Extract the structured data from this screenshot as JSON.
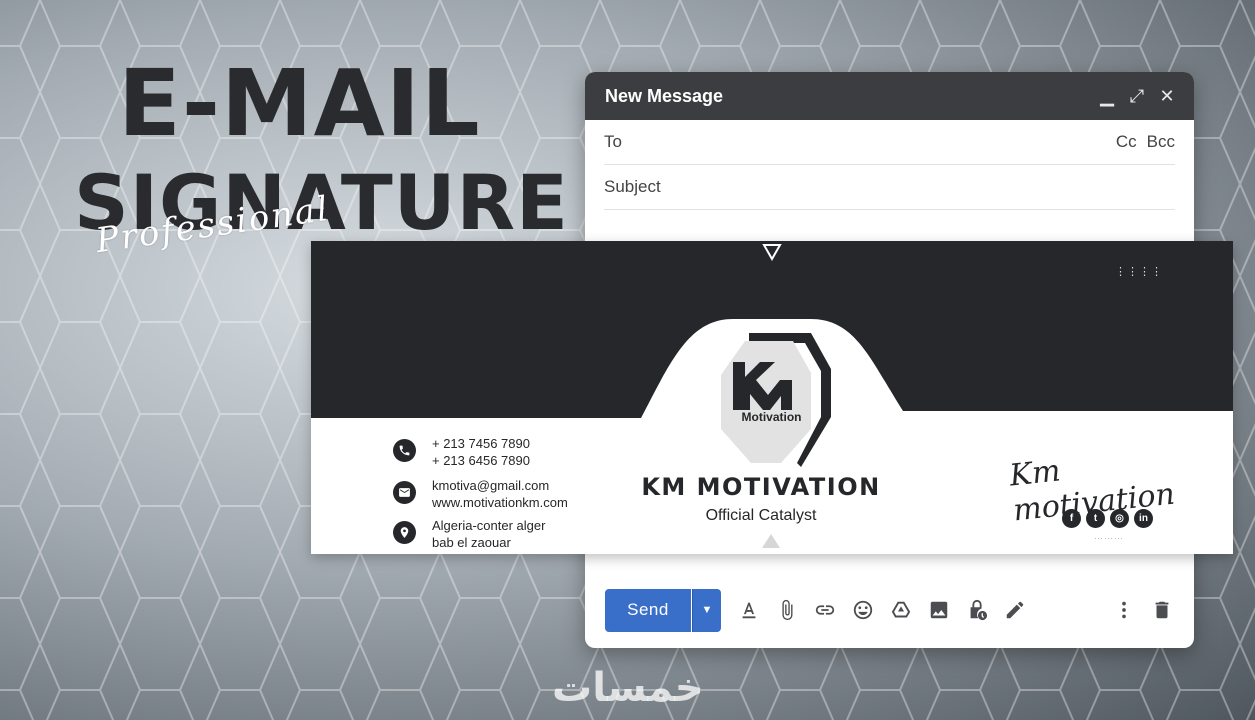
{
  "hero": {
    "line1": "E-MAIL",
    "line2": "SIGNATURE",
    "script": "Professional"
  },
  "compose": {
    "title": "New Message",
    "controls": [
      "minimize-icon",
      "expand-icon",
      "close-icon"
    ],
    "to_label": "To",
    "cc_label": "Cc",
    "bcc_label": "Bcc",
    "subject_label": "Subject",
    "send_label": "Send",
    "toolbar_icons": [
      "text-format-icon",
      "attach-icon",
      "link-icon",
      "emoji-icon",
      "drive-icon",
      "image-icon",
      "confidential-icon",
      "signature-pen-icon",
      "more-options-icon",
      "trash-icon"
    ]
  },
  "signature": {
    "phones": [
      "+ 213 7456 7890",
      "+ 213 6456 7890"
    ],
    "email": "kmotiva@gmail.com",
    "website": "www.motivationkm.com",
    "address": [
      "Algeria-conter alger",
      "bab el zaouar"
    ],
    "logo_letters": "Km",
    "logo_word": "Motivation",
    "brand_name": "KM MOTIVATION",
    "tagline": "Official Catalyst",
    "script": "Km motivation",
    "socials": [
      {
        "name": "facebook-icon",
        "glyph": "f"
      },
      {
        "name": "twitter-icon",
        "glyph": "t"
      },
      {
        "name": "instagram-icon",
        "glyph": "◎"
      },
      {
        "name": "linkedin-icon",
        "glyph": "in"
      }
    ],
    "colors": {
      "dark": "#26272a",
      "send": "#3a6fc9"
    }
  }
}
